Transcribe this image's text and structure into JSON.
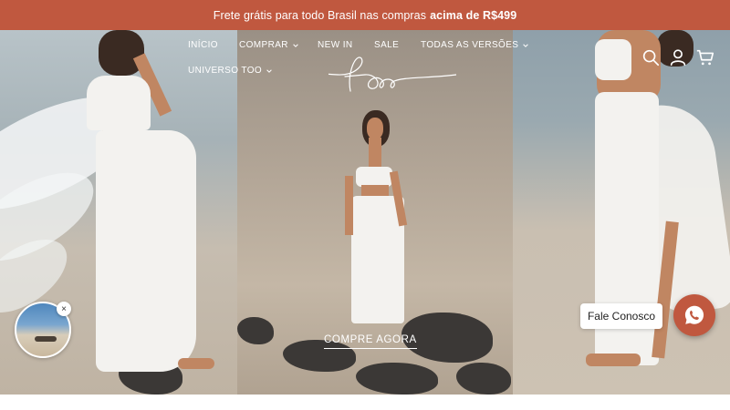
{
  "announcement": {
    "text": "Frete grátis para todo Brasil nas compras",
    "highlight": "acima de R$499"
  },
  "nav": {
    "items": [
      {
        "label": "INÍCIO",
        "has_dropdown": false
      },
      {
        "label": "COMPRAR",
        "has_dropdown": true
      },
      {
        "label": "NEW IN",
        "has_dropdown": false
      },
      {
        "label": "SALE",
        "has_dropdown": false
      },
      {
        "label": "TODAS AS VERSÕES",
        "has_dropdown": true
      },
      {
        "label": "UNIVERSO TOO",
        "has_dropdown": true
      }
    ]
  },
  "brand": {
    "logo_text": "too",
    "logo_color": "#ffffff"
  },
  "header_icons": {
    "search": "search-icon",
    "account": "user-icon",
    "cart": "cart-icon"
  },
  "hero": {
    "cta_label": "COMPRE AGORA"
  },
  "chat": {
    "label": "Fale Conosco",
    "icon": "whatsapp-icon"
  },
  "promo_popup": {
    "close_symbol": "×"
  },
  "colors": {
    "brand_accent": "#c0583f",
    "nav_text": "#ffffff"
  }
}
